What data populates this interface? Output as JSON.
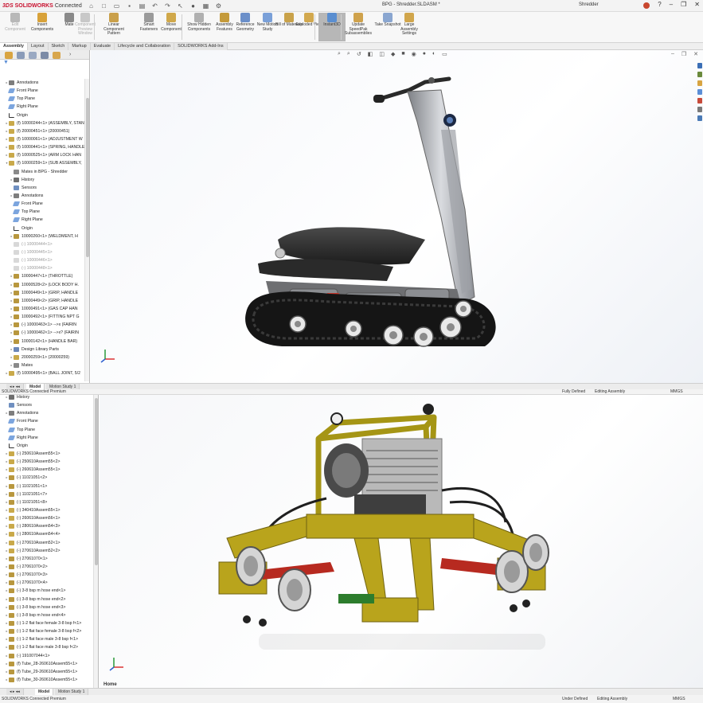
{
  "titlebar": {
    "brand": "SOLIDWORKS",
    "connected": "Connected",
    "document_title": "BPG - Shredder.SLDASM *",
    "user": "Shredder"
  },
  "ribbon": {
    "buttons": [
      {
        "label": "Edit Component",
        "icon_color": "#b8b8b8",
        "dim": true
      },
      {
        "label": "Insert Components",
        "icon_color": "#d8a23a"
      },
      {
        "label": "Mate",
        "icon_color": "#8a8a8a"
      },
      {
        "label": "Component Preview Window",
        "icon_color": "#c8c8c8",
        "dim": true
      },
      {
        "label": "Linear Component Pattern",
        "icon_color": "#caa04a"
      },
      {
        "label": "Smart Fasteners",
        "icon_color": "#9a9a9a"
      },
      {
        "label": "Move Component",
        "icon_color": "#d0a84a"
      },
      {
        "label": "Show Hidden Components",
        "icon_color": "#b0b0b0"
      },
      {
        "label": "Assembly Features",
        "icon_color": "#c49a3a"
      },
      {
        "label": "Reference Geometry",
        "icon_color": "#6b8fc9"
      },
      {
        "label": "New Motion Study",
        "icon_color": "#7aa0d8"
      },
      {
        "label": "Bill of Materials",
        "icon_color": "#c9a24a"
      },
      {
        "label": "Exploded View",
        "icon_color": "#d2a84e"
      },
      {
        "label": "Instant3D",
        "icon_color": "#5a8ed0",
        "active": true
      },
      {
        "label": "Update SpeedPak Subassemblies",
        "icon_color": "#cfa24c"
      },
      {
        "label": "Take Snapshot",
        "icon_color": "#8aa6d0"
      },
      {
        "label": "Large Assembly Settings",
        "icon_color": "#d1a64c"
      }
    ]
  },
  "command_tabs": [
    "Assembly",
    "Layout",
    "Sketch",
    "Markup",
    "Evaluate",
    "Lifecycle and Collaboration",
    "SOLIDWORKS Add-Ins"
  ],
  "top_tree": {
    "items": [
      {
        "label": "Annotations",
        "icon": "annotation-icon",
        "indent": 1,
        "exp": "▸"
      },
      {
        "label": "Front Plane",
        "icon": "plane-icon",
        "indent": 1
      },
      {
        "label": "Top Plane",
        "icon": "plane-icon",
        "indent": 1
      },
      {
        "label": "Right Plane",
        "icon": "plane-icon",
        "indent": 1
      },
      {
        "label": "Origin",
        "icon": "origin-icon",
        "indent": 1
      },
      {
        "label": "(f) 10000244<1> (ASSEMBLY, STAND",
        "icon": "assembly-icon",
        "indent": 1,
        "exp": "▸"
      },
      {
        "label": "(f) 20000451<1> (20000451)",
        "icon": "assembly-icon",
        "indent": 1,
        "exp": "▸"
      },
      {
        "label": "(f) 10000061<1> (ADJUSTMENT W",
        "icon": "assembly-icon",
        "indent": 1,
        "exp": "▸"
      },
      {
        "label": "(f) 10000441<1> (SPRING, HANDLE",
        "icon": "assembly-icon",
        "indent": 1,
        "exp": "▸"
      },
      {
        "label": "(f) 10000525<1> (ARM LOCK HAN",
        "icon": "assembly-icon",
        "indent": 1,
        "exp": "▸"
      },
      {
        "label": "(f) 10000259<1> (SUB ASSEMBLY,",
        "icon": "assembly-icon",
        "indent": 1,
        "exp": "▾"
      },
      {
        "label": "Mates in BPG - Shredder",
        "icon": "mates-icon",
        "indent": 2
      },
      {
        "label": "History",
        "icon": "history-icon",
        "indent": 2,
        "exp": "▸"
      },
      {
        "label": "Sensors",
        "icon": "sensor-icon",
        "indent": 2
      },
      {
        "label": "Annotations",
        "icon": "annotation-icon",
        "indent": 2,
        "exp": "▸"
      },
      {
        "label": "Front Plane",
        "icon": "plane-icon",
        "indent": 2
      },
      {
        "label": "Top Plane",
        "icon": "plane-icon",
        "indent": 2
      },
      {
        "label": "Right Plane",
        "icon": "plane-icon",
        "indent": 2
      },
      {
        "label": "Origin",
        "icon": "origin-icon",
        "indent": 2
      },
      {
        "label": "10000260<1> (WELDMENT, H",
        "icon": "part-icon",
        "indent": 2,
        "exp": "▸"
      },
      {
        "label": "(-) 10000444<1>",
        "icon": "part-dim-icon",
        "indent": 2,
        "dim": true
      },
      {
        "label": "(-) 10000445<1>",
        "icon": "part-dim-icon",
        "indent": 2,
        "dim": true
      },
      {
        "label": "(-) 10000446<1>",
        "icon": "part-dim-icon",
        "indent": 2,
        "dim": true
      },
      {
        "label": "(-) 10000448<1>",
        "icon": "part-dim-icon",
        "indent": 2,
        "dim": true
      },
      {
        "label": "10000447<1> (THROTTLE)",
        "icon": "part-icon",
        "indent": 2,
        "exp": "▸"
      },
      {
        "label": "10000528<2> (LOCK BODY H.",
        "icon": "part-icon",
        "indent": 2,
        "exp": "▸"
      },
      {
        "label": "10000449<1> (GRIP, HANDLE",
        "icon": "part-icon",
        "indent": 2,
        "exp": "▸"
      },
      {
        "label": "10000449<2> (GRIP, HANDLE",
        "icon": "part-icon",
        "indent": 2,
        "exp": "▸"
      },
      {
        "label": "10000491<1> (GAS CAP HAN",
        "icon": "part-icon",
        "indent": 2,
        "exp": "▸"
      },
      {
        "label": "10000492<1> (FITTING NPT G",
        "icon": "part-icon",
        "indent": 2,
        "exp": "▸"
      },
      {
        "label": "(-) 10000463<1> -->x (FAIRIN",
        "icon": "part-icon",
        "indent": 2,
        "exp": "▸"
      },
      {
        "label": "(-) 10000462<1> -->x? (FAIRIN",
        "icon": "part-icon",
        "indent": 2,
        "exp": "▸"
      },
      {
        "label": "10000142<1> (HANDLE BAR)",
        "icon": "part-icon",
        "indent": 2,
        "exp": "▸"
      },
      {
        "label": "Design Library Parts",
        "icon": "folder-icon",
        "indent": 2,
        "exp": "▸"
      },
      {
        "label": "20000259<1> (20000259)",
        "icon": "assembly-icon",
        "indent": 2,
        "exp": "▸"
      },
      {
        "label": "Mates",
        "icon": "mates-icon",
        "indent": 2,
        "exp": "▸"
      },
      {
        "label": "(f) 10000495<1> (BALL JOINT, 5/2",
        "icon": "assembly-icon",
        "indent": 1,
        "exp": "▸"
      }
    ]
  },
  "mid_tabs": [
    "Model",
    "Motion Study 1"
  ],
  "status_top": {
    "product": "SOLIDWORKS Connected Premium",
    "state": "Fully Defined",
    "mode": "Editing Assembly",
    "units": "MMGS"
  },
  "bottom_tree": {
    "items": [
      {
        "label": "History",
        "icon": "history-icon",
        "exp": "▸"
      },
      {
        "label": "Sensors",
        "icon": "sensor-icon"
      },
      {
        "label": "Annotations",
        "icon": "annotation-icon",
        "exp": "▸"
      },
      {
        "label": "Front Plane",
        "icon": "plane-icon"
      },
      {
        "label": "Top Plane",
        "icon": "plane-icon"
      },
      {
        "label": "Right Plane",
        "icon": "plane-icon"
      },
      {
        "label": "Origin",
        "icon": "origin-icon"
      },
      {
        "label": "(-) 250610Assem55<1>",
        "icon": "assembly-icon",
        "exp": "▸"
      },
      {
        "label": "(-) 250610Assem55<2>",
        "icon": "assembly-icon",
        "exp": "▸"
      },
      {
        "label": "(-) 260610Assem55<1>",
        "icon": "assembly-icon",
        "exp": "▸"
      },
      {
        "label": "(-) 11021051<2>",
        "icon": "part-icon",
        "exp": "▸"
      },
      {
        "label": "(-) 11021051<1>",
        "icon": "part-icon",
        "exp": "▸"
      },
      {
        "label": "(-) 11021051<7>",
        "icon": "part-icon",
        "exp": "▸"
      },
      {
        "label": "(-) 11021051<8>",
        "icon": "part-icon",
        "exp": "▸"
      },
      {
        "label": "(-) 340410Assem55<1>",
        "icon": "assembly-icon",
        "exp": "▸"
      },
      {
        "label": "(-) 260610Assem56<1>",
        "icon": "assembly-icon",
        "exp": "▸"
      },
      {
        "label": "(-) 280610Assem54<3>",
        "icon": "assembly-icon",
        "exp": "▸"
      },
      {
        "label": "(-) 280610Assem54<4>",
        "icon": "assembly-icon",
        "exp": "▸"
      },
      {
        "label": "(-) 270610Assem52<1>",
        "icon": "assembly-icon",
        "exp": "▸"
      },
      {
        "label": "(-) 270610Assem52<2>",
        "icon": "assembly-icon",
        "exp": "▸"
      },
      {
        "label": "(-) 27061070<1>",
        "icon": "part-icon",
        "exp": "▸"
      },
      {
        "label": "(-) 27061070<2>",
        "icon": "part-icon",
        "exp": "▸"
      },
      {
        "label": "(-) 27061070<3>",
        "icon": "part-icon",
        "exp": "▸"
      },
      {
        "label": "(-) 27061070<4>",
        "icon": "part-icon",
        "exp": "▸"
      },
      {
        "label": "(-) 3-8 bsp m hose end<1>",
        "icon": "part-icon",
        "exp": "▸"
      },
      {
        "label": "(-) 3-8 bsp m hose end<2>",
        "icon": "part-icon",
        "exp": "▸"
      },
      {
        "label": "(-) 3-8 bsp m hose end<3>",
        "icon": "part-icon",
        "exp": "▸"
      },
      {
        "label": "(-) 3-8 bsp m hose end<4>",
        "icon": "part-icon",
        "exp": "▸"
      },
      {
        "label": "(-) 1-2 flat face female 3-8 bsp f<1>",
        "icon": "part-icon",
        "exp": "▸"
      },
      {
        "label": "(-) 1-2 flat face female 3-8 bsp f<2>",
        "icon": "part-icon",
        "exp": "▸"
      },
      {
        "label": "(-) 1-2 flat face male 3-8 bsp f<1>",
        "icon": "part-icon",
        "exp": "▸"
      },
      {
        "label": "(-) 1-2 flat face male 3-8 bsp f<2>",
        "icon": "part-icon",
        "exp": "▸"
      },
      {
        "label": "(-) 191007044<1>",
        "icon": "part-icon",
        "exp": "▸"
      },
      {
        "label": "(f) Tube_28-260610Assem55<1>",
        "icon": "part-icon",
        "exp": "▸"
      },
      {
        "label": "(f) Tube_29-260610Assem55<1>",
        "icon": "part-icon",
        "exp": "▸"
      },
      {
        "label": "(f) Tube_30-260610Assem55<1>",
        "icon": "part-icon",
        "exp": "▸"
      }
    ]
  },
  "viewport_bottom": {
    "home_label": "Home"
  },
  "bottom_tabs": [
    "Model",
    "Motion Study 1"
  ],
  "status_bottom": {
    "product": "SOLIDWORKS Connected Premium",
    "state": "Under Defined",
    "mode": "Editing Assembly",
    "units": "MMGS"
  },
  "colors": {
    "brand": "#c8102e",
    "assembly_icon": "#c9a94a",
    "part_icon": "#b8973e",
    "plane_icon": "#5b8ed6",
    "machine_yellow": "#b9a41c"
  }
}
